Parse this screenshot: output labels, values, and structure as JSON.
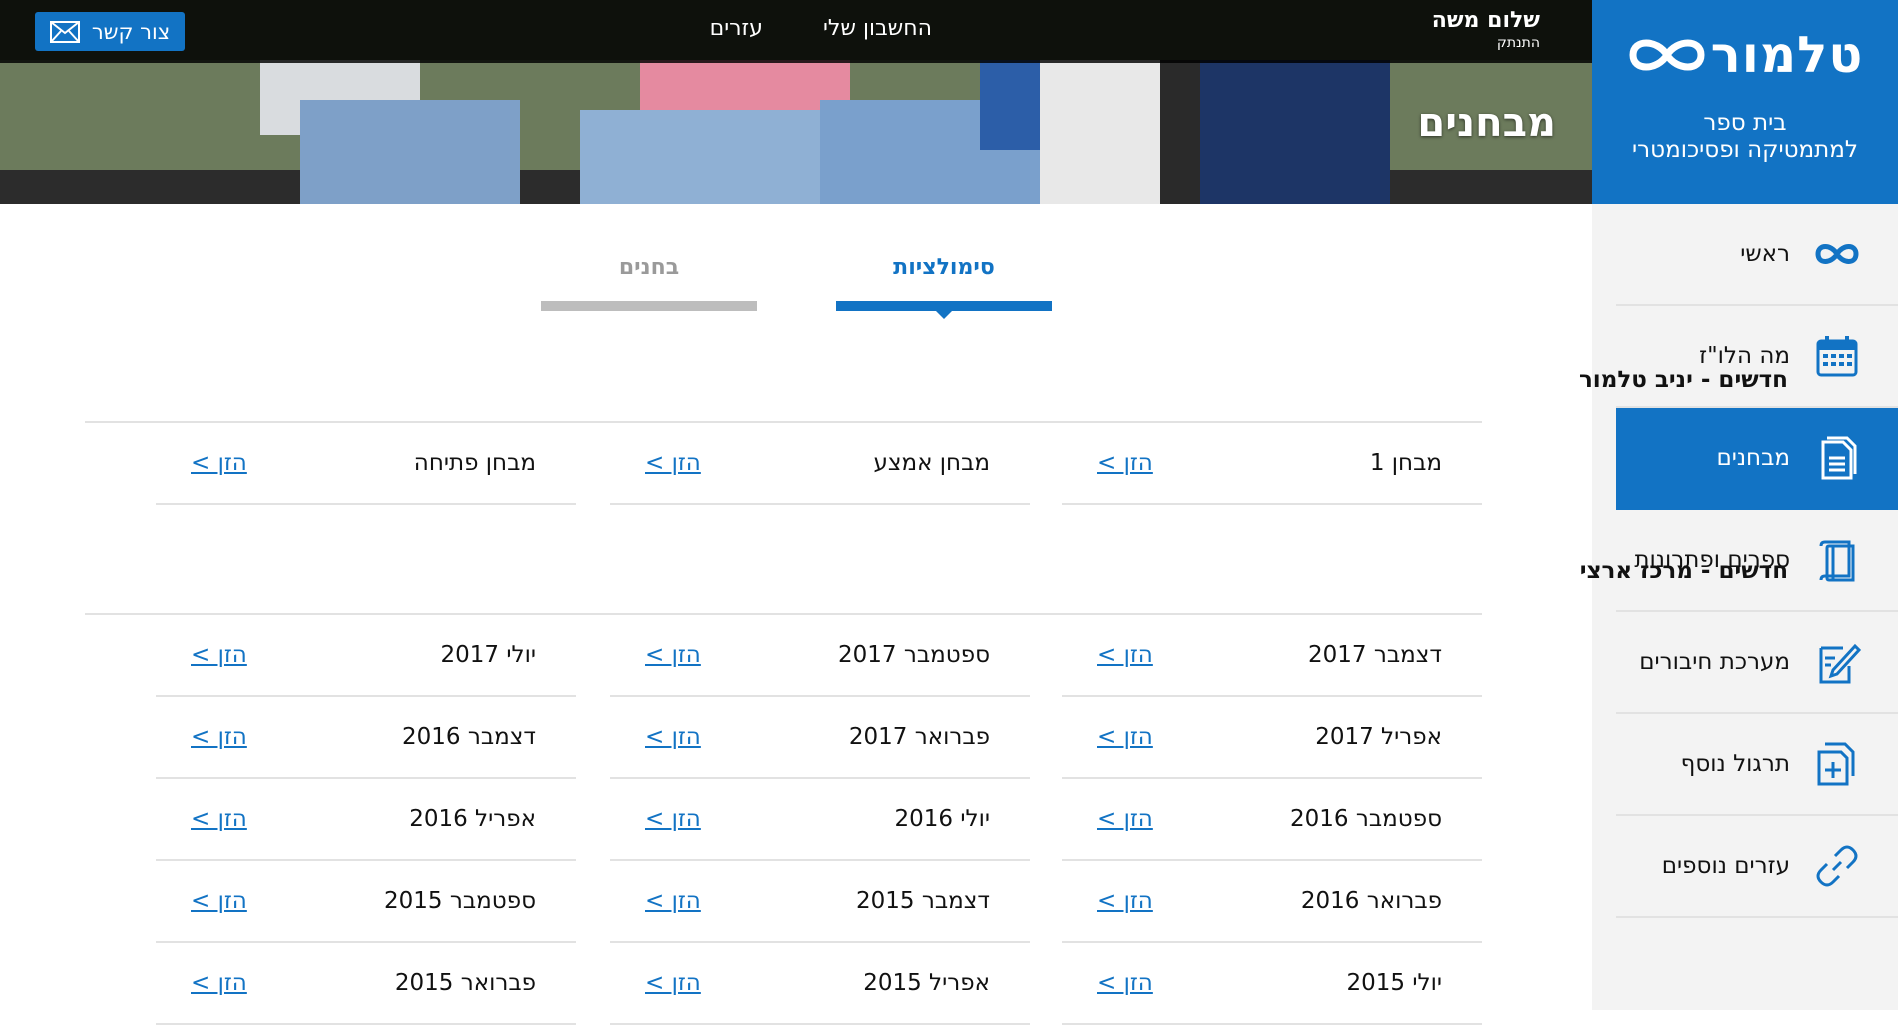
{
  "sidebar": {
    "logo": "טלמור",
    "tagline_line1": "בית ספר",
    "tagline_line2": "למתמטיקה ופסיכומטרי",
    "items": [
      {
        "label": "ראשי",
        "icon": "infinity-icon"
      },
      {
        "label": "מה הלו\"ז",
        "icon": "calendar-icon"
      },
      {
        "label": "מבחנים",
        "icon": "document-icon",
        "active": true
      },
      {
        "label": "ספרים ופתרונות",
        "icon": "books-icon"
      },
      {
        "label": "מערכת חיבורים",
        "icon": "pen-paper-icon"
      },
      {
        "label": "תרגול נוסף",
        "icon": "add-document-icon"
      },
      {
        "label": "עזרים נוספים",
        "icon": "link-icon"
      }
    ]
  },
  "header": {
    "greeting": "שלום משה",
    "logout": "התנתק",
    "links": [
      "החשבון שלי",
      "עזרים"
    ],
    "contact": "צור קשר",
    "page_title": "מבחנים"
  },
  "tabs": {
    "simulations": "סימולציות",
    "exams": "בחנים"
  },
  "sections": [
    {
      "title": "חדשים - יניב טלמור",
      "rows": [
        [
          "מבחן 1",
          "מבחן אמצע",
          "מבחן פתיחה"
        ]
      ]
    },
    {
      "title": "חדשים - מרכז ארצי",
      "rows": [
        [
          "דצמבר 2017",
          "ספטמבר 2017",
          "יולי 2017"
        ],
        [
          "אפריל 2017",
          "פברואר 2017",
          "דצמבר 2016"
        ],
        [
          "ספטמבר 2016",
          "יולי 2016",
          "אפריל 2016"
        ],
        [
          "פברואר 2016",
          "דצמבר 2015",
          "ספטמבר 2015"
        ],
        [
          "יולי 2015",
          "אפריל 2015",
          "פברואר 2015"
        ]
      ]
    }
  ],
  "enter_link": "הזן >",
  "colors": {
    "brand": "#1273c4",
    "sidebar_bg": "#f3f3f3"
  }
}
